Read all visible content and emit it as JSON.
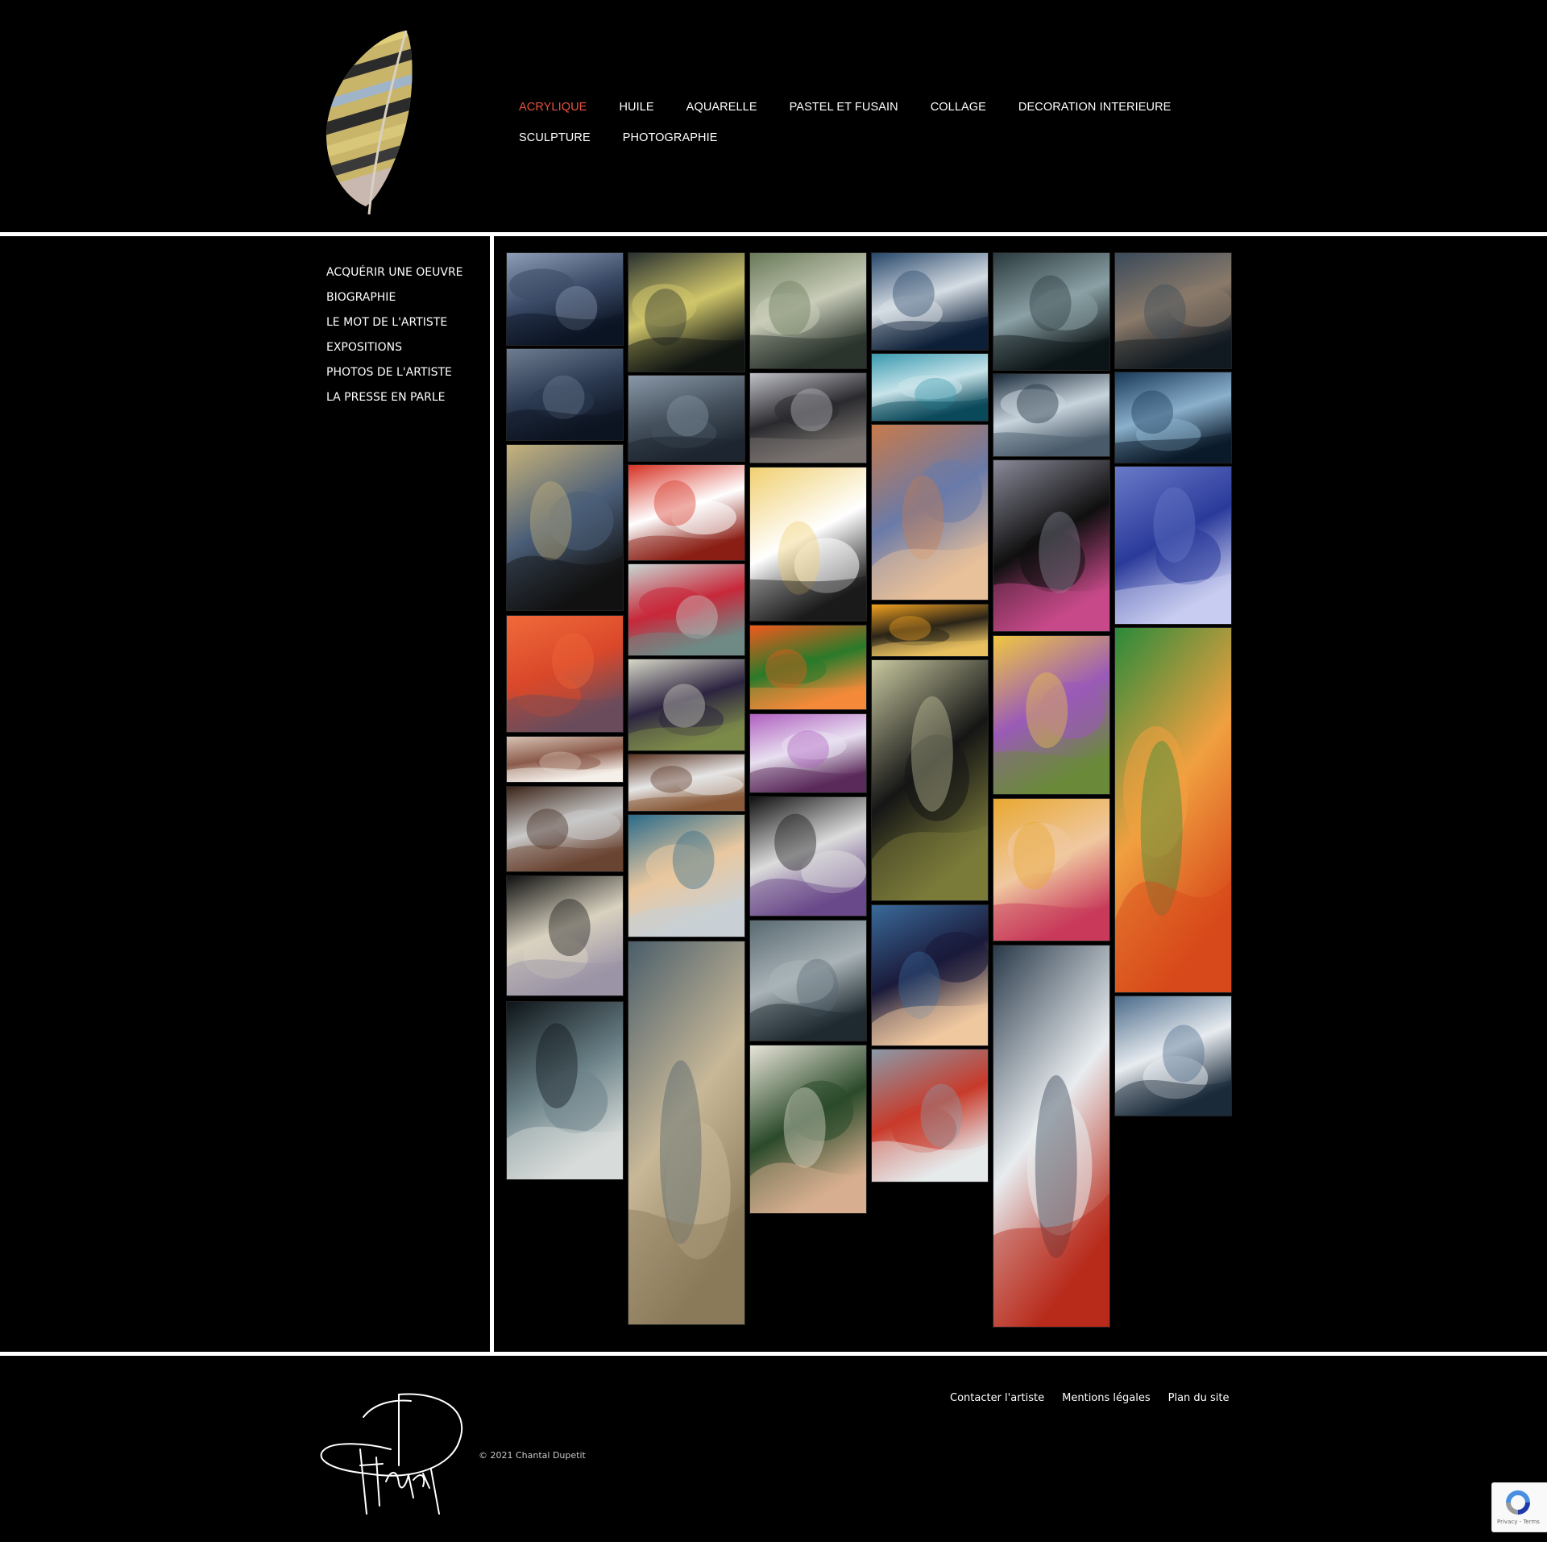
{
  "header": {
    "logo": "feather-logo",
    "nav": [
      {
        "label": "ACRYLIQUE",
        "active": true
      },
      {
        "label": "HUILE"
      },
      {
        "label": "AQUARELLE"
      },
      {
        "label": "PASTEL ET FUSAIN"
      },
      {
        "label": "COLLAGE"
      },
      {
        "label": "DECORATION INTERIEURE"
      },
      {
        "label": "SCULPTURE"
      },
      {
        "label": "PHOTOGRAPHIE"
      }
    ],
    "active_color": "#e8523e"
  },
  "sidebar": {
    "items": [
      {
        "label": "ACQUÉRIR UNE OEUVRE"
      },
      {
        "label": "BIOGRAPHIE"
      },
      {
        "label": "LE MOT DE L'ARTISTE"
      },
      {
        "label": "EXPOSITIONS"
      },
      {
        "label": "PHOTOS DE L'ARTISTE"
      },
      {
        "label": "LA PRESSE EN PARLE"
      }
    ]
  },
  "gallery": {
    "thumbnails": [
      {
        "subject": "seascape-cliffs",
        "palette": [
          "#8e9db6",
          "#3a4a66",
          "#0c1424"
        ]
      },
      {
        "subject": "seascape-night",
        "palette": [
          "#6f7d92",
          "#2c3a52",
          "#0d1522"
        ]
      },
      {
        "subject": "woman-portrait-blonde",
        "palette": [
          "#c8b37a",
          "#4b5e78",
          "#111111"
        ]
      },
      {
        "subject": "red-poppy-flower",
        "palette": [
          "#f16a3a",
          "#d9482a",
          "#6a4c5c"
        ]
      },
      {
        "subject": "white-flowers-branch",
        "palette": [
          "#d8c2b4",
          "#8a5a4a",
          "#f4efe8"
        ]
      },
      {
        "subject": "white-flower-diptych",
        "palette": [
          "#3b2418",
          "#c9c9c9",
          "#6a4432"
        ]
      },
      {
        "subject": "girl-white-hair",
        "palette": [
          "#111111",
          "#d9d2c0",
          "#9c94a6"
        ]
      },
      {
        "subject": "stormy-wave",
        "palette": [
          "#0d1418",
          "#6b8288",
          "#d8dcda"
        ]
      },
      {
        "subject": "buoy-yellow",
        "palette": [
          "#2a3230",
          "#cfc56a",
          "#0f1412"
        ]
      },
      {
        "subject": "grey-sea",
        "palette": [
          "#8a98a8",
          "#46525e",
          "#1d2630"
        ]
      },
      {
        "subject": "red-poppy-large",
        "palette": [
          "#d63224",
          "#ffffff",
          "#8a1e14"
        ]
      },
      {
        "subject": "red-poppies-field",
        "palette": [
          "#c8d8d4",
          "#c8283a",
          "#6f8a86"
        ]
      },
      {
        "subject": "olive-branches",
        "palette": [
          "#d8d8c8",
          "#2c2440",
          "#7c8a4a"
        ]
      },
      {
        "subject": "white-flowers-triptych",
        "palette": [
          "#5a3220",
          "#e6e6e6",
          "#8a5a3a"
        ]
      },
      {
        "subject": "girl-blue-hat",
        "palette": [
          "#2a6a8a",
          "#e9c8a0",
          "#c8d0d6"
        ]
      },
      {
        "subject": "dune-path",
        "palette": [
          "#4a5e6a",
          "#c8b898",
          "#8a7a5a"
        ]
      },
      {
        "subject": "buoy-green-sea",
        "palette": [
          "#6a7a5a",
          "#c8ccb8",
          "#2a342c"
        ]
      },
      {
        "subject": "beach-fence",
        "palette": [
          "#c0c0c8",
          "#2a2a2e",
          "#7a7470"
        ]
      },
      {
        "subject": "calla-lily",
        "palette": [
          "#f0d070",
          "#ffffff",
          "#1a1a1a"
        ]
      },
      {
        "subject": "orange-lily",
        "palette": [
          "#f05a1c",
          "#2a7a2a",
          "#f48a3a"
        ]
      },
      {
        "subject": "pink-orchid-panels",
        "palette": [
          "#b060c0",
          "#e8e0f0",
          "#5a2a5a"
        ]
      },
      {
        "subject": "girl-flower-hat",
        "palette": [
          "#111111",
          "#dcdcdc",
          "#6a4a8a"
        ]
      },
      {
        "subject": "grey-waves",
        "palette": [
          "#5a6a72",
          "#aab4b8",
          "#1e2a30"
        ]
      },
      {
        "subject": "woman-black-hat-beach",
        "palette": [
          "#e8e4d8",
          "#2a4a2a",
          "#d8b090"
        ]
      },
      {
        "subject": "big-wave-blue",
        "palette": [
          "#27476a",
          "#d6dde4",
          "#0d2038"
        ]
      },
      {
        "subject": "turquoise-sea",
        "palette": [
          "#3a9ab0",
          "#c8e4ea",
          "#0a4a5a"
        ]
      },
      {
        "subject": "two-women-figures",
        "palette": [
          "#c87a4a",
          "#6a7aa8",
          "#e8c09a"
        ]
      },
      {
        "subject": "sunflowers",
        "palette": [
          "#f0a020",
          "#2a2418",
          "#e8c060"
        ]
      },
      {
        "subject": "olives-large",
        "palette": [
          "#c8c8a0",
          "#151515",
          "#7a7a3a"
        ]
      },
      {
        "subject": "manga-girl-purple",
        "palette": [
          "#3a6a9a",
          "#1a1a3a",
          "#f0c8a0"
        ]
      },
      {
        "subject": "boat-in-harbor",
        "palette": [
          "#8a9aa8",
          "#c83a2a",
          "#e6eaec"
        ]
      },
      {
        "subject": "night-sea-reeds",
        "palette": [
          "#2a3a3e",
          "#8aa0a4",
          "#0c1416"
        ]
      },
      {
        "subject": "moonlit-waves",
        "palette": [
          "#1a2a3a",
          "#c8d4dc",
          "#4a5a6a"
        ]
      },
      {
        "subject": "woman-black-dress-bouquet",
        "palette": [
          "#8a8a9a",
          "#0f0f0f",
          "#c84a8a"
        ]
      },
      {
        "subject": "purple-iris-yellow",
        "palette": [
          "#f0c840",
          "#9a5ab8",
          "#6a8a3a"
        ]
      },
      {
        "subject": "manga-girl-blonde",
        "palette": [
          "#e8a830",
          "#f0c8a0",
          "#c83a5a"
        ]
      },
      {
        "subject": "lighthouse-storm",
        "palette": [
          "#2a3a4a",
          "#e8ecef",
          "#b82a1a"
        ]
      },
      {
        "subject": "dark-sea-horizon",
        "palette": [
          "#3a4a5a",
          "#8a7a6a",
          "#121a22"
        ]
      },
      {
        "subject": "blue-sea-reflection",
        "palette": [
          "#1a3a5a",
          "#8ab0cc",
          "#0a1a2a"
        ]
      },
      {
        "subject": "blue-iris",
        "palette": [
          "#6a7ac8",
          "#2a3a9a",
          "#c8ccf0"
        ]
      },
      {
        "subject": "orange-lilies-green",
        "palette": [
          "#2a8a3a",
          "#f0a040",
          "#d84a1a"
        ]
      },
      {
        "subject": "abstract-music-blue",
        "palette": [
          "#4a6a8a",
          "#e8ecf0",
          "#1a2a3a"
        ]
      }
    ]
  },
  "footer": {
    "signature": "artist-signature",
    "copyright": "© 2021 Chantal Dupetit",
    "links": [
      {
        "label": "Contacter l'artiste"
      },
      {
        "label": "Mentions légales"
      },
      {
        "label": "Plan du site"
      }
    ]
  },
  "recaptcha": {
    "text": "Privacy - Terms",
    "icon": "recaptcha-icon"
  }
}
